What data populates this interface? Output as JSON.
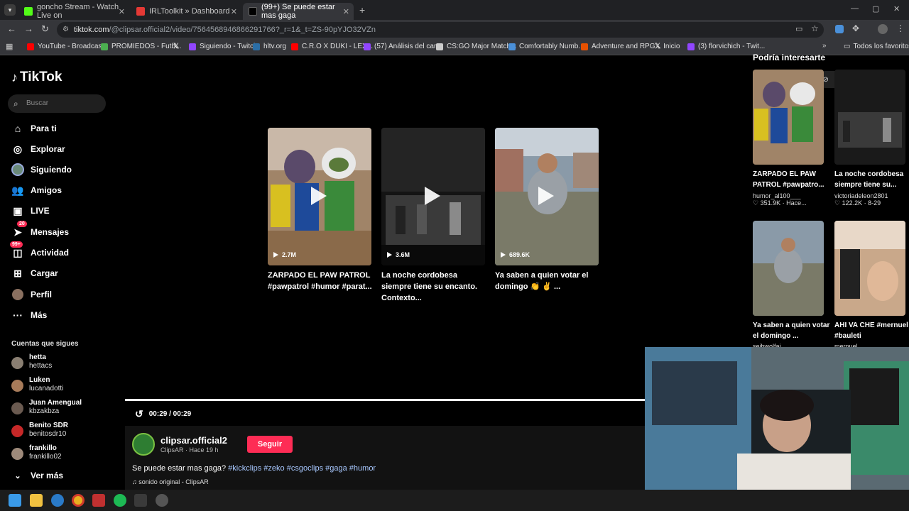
{
  "browser": {
    "tabs": [
      {
        "title": "goncho Stream - Watch Live on",
        "favicon_color": "#53fc18"
      },
      {
        "title": "IRLToolkit » Dashboard",
        "favicon_color": "#e53935"
      },
      {
        "title": "(99+) Se puede estar mas gaga",
        "favicon_color": "#000000"
      }
    ],
    "url_main": "tiktok.com",
    "url_rest": "/@clipsar.official2/video/7564568946866291766?_r=1&_t=ZS-90pYJO32VZn",
    "bookmarks": [
      {
        "label": "YouTube - Broadcas...",
        "color": "#ff0000"
      },
      {
        "label": "PROMIEDOS - Futb...",
        "color": "#4caf50"
      },
      {
        "label": "",
        "color": "#000000"
      },
      {
        "label": "Siguiendo - Twitch",
        "color": "#9146ff"
      },
      {
        "label": "hltv.org",
        "color": "#2b6ea6"
      },
      {
        "label": "C.R.O X DUKI - LEX...",
        "color": "#ff0000"
      },
      {
        "label": "(57) Análisis del can...",
        "color": "#9146ff"
      },
      {
        "label": "CS:GO Major Match...",
        "color": "#cccccc"
      },
      {
        "label": "Comfortably Numb...",
        "color": "#4a90d9"
      },
      {
        "label": "Adventure and RPG...",
        "color": "#e65100"
      },
      {
        "label": "Inicio",
        "color": "#000000"
      },
      {
        "label": "(3) florvichich - Twit...",
        "color": "#9146ff"
      }
    ],
    "all_bookmarks": "Todos los favoritos"
  },
  "sidebar": {
    "logo": "TikTok",
    "search_placeholder": "Buscar",
    "nav": [
      {
        "label": "Para ti",
        "icon": "home-icon"
      },
      {
        "label": "Explorar",
        "icon": "compass-icon"
      },
      {
        "label": "Siguiendo",
        "icon": "avatar-icon"
      },
      {
        "label": "Amigos",
        "icon": "friends-icon"
      },
      {
        "label": "LIVE",
        "icon": "live-icon"
      },
      {
        "label": "Mensajes",
        "icon": "message-icon",
        "badge": "20"
      },
      {
        "label": "Actividad",
        "icon": "activity-icon",
        "badge": "99+"
      },
      {
        "label": "Cargar",
        "icon": "upload-icon"
      },
      {
        "label": "Perfil",
        "icon": "profile-icon"
      },
      {
        "label": "Más",
        "icon": "more-icon"
      }
    ],
    "following_title": "Cuentas que sigues",
    "following": [
      {
        "name": "hetta",
        "handle": "hettacs",
        "color": "#8a7f72"
      },
      {
        "name": "Luken",
        "handle": "lucanadotti",
        "color": "#a77b5a"
      },
      {
        "name": "Juan Amengual",
        "handle": "kbzakbza",
        "color": "#6a5a50"
      },
      {
        "name": "Benito SDR",
        "handle": "benitosdr10",
        "color": "#c62828"
      },
      {
        "name": "frankillo",
        "handle": "frankillo02",
        "color": "#9e8a7a"
      }
    ],
    "see_more": "Ver más"
  },
  "videos": [
    {
      "views": "2.7M",
      "title": "ZARPADO EL PAW PATROL #pawpatrol #humor #parat..."
    },
    {
      "views": "3.6M",
      "title": "La noche cordobesa siempre tiene su encanto. Contexto..."
    },
    {
      "views": "689.6K",
      "title": "Ya saben a quien votar el domingo 👏 ✌ ..."
    }
  ],
  "player": {
    "time": "00:29 / 00:29",
    "author_name": "clipsar.official2",
    "author_meta": "ClipsAR · Hace 19 h",
    "follow_label": "Seguir",
    "description_text": "Se puede estar mas gaga?",
    "hashtags": [
      "#kickclips",
      "#zeko",
      "#csgoclips",
      "#gaga",
      "#humor"
    ],
    "sound": "sonido original - ClipsAR"
  },
  "related": {
    "title": "Podría interesarte",
    "items": [
      {
        "title": "ZARPADO EL PAW PATROL #pawpatro...",
        "user": "humor_al100___",
        "likes": "351.9K",
        "date": "Hace..."
      },
      {
        "title": "La noche cordobesa siempre tiene su...",
        "user": "victoriadeleon2801",
        "likes": "122.2K",
        "date": "8-29"
      },
      {
        "title": "Ya saben a quien votar el domingo ...",
        "user": "seibwolfai",
        "likes": "",
        "date": ""
      },
      {
        "title": "AHI VA CHE #mernuel #bauleti",
        "user": "mernuel",
        "likes": "",
        "date": ""
      }
    ]
  }
}
